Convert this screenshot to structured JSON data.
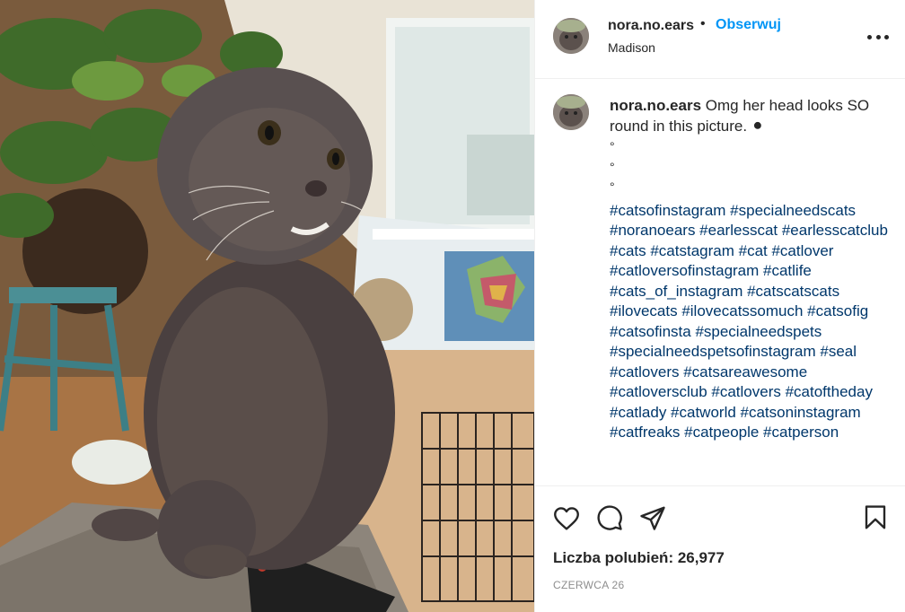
{
  "post": {
    "photo_icon": "cat-photo",
    "username": "nora.no.ears",
    "separator": "•",
    "follow_label": "Obserwuj",
    "location": "Madison",
    "more_icon": "more-options-icon"
  },
  "caption": {
    "username": "nora.no.ears",
    "text": "Omg her head looks SO round in this picture. ⚫",
    "bullets": [
      "°",
      "°",
      "°"
    ],
    "hashtags": "#catsofinstagram #specialneedscats #noranoears #earlesscat #earlesscatclub #cats #catstagram #cat #catlover #catloversofinstagram #catlife #cats_of_instagram #catscatscats #ilovecats #ilovecatssomuch #catsofig #catsofinsta #specialneedspets #specialneedspetsofinstagram #seal #catlovers #catsareawesome #catloversclub #catlovers #catoftheday #catlady #catworld #catsoninstagram #catfreaks #catpeople #catperson"
  },
  "actions": {
    "like_icon": "heart-icon",
    "comment_icon": "comment-icon",
    "share_icon": "share-icon",
    "save_icon": "bookmark-icon"
  },
  "likes": {
    "text": "Liczba polubień: 26,977"
  },
  "date": "CZERWCA 26",
  "colors": {
    "link_blue": "#0095f6",
    "hashtag_blue": "#00376b",
    "text": "#262626",
    "muted": "#8e8e8e",
    "divider": "#efefef"
  }
}
